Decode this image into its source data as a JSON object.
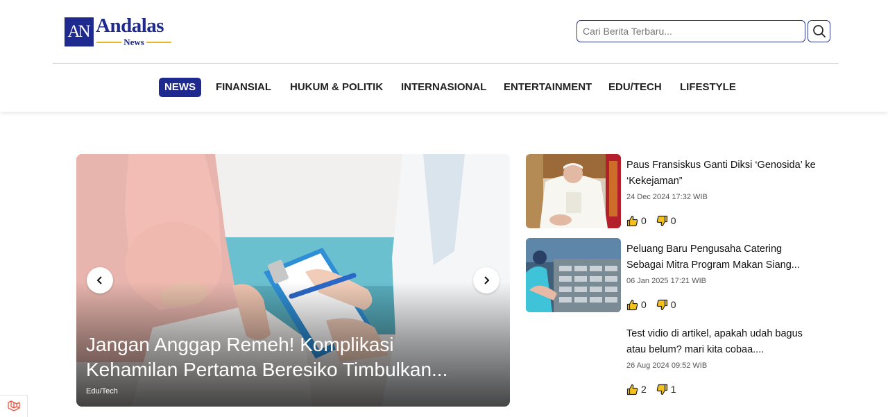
{
  "brand": {
    "mark": "AN",
    "name": "Andalas",
    "sub": "News"
  },
  "search": {
    "placeholder": "Cari Berita Terbaru..."
  },
  "nav": [
    {
      "label": "NEWS",
      "active": true
    },
    {
      "label": "FINANSIAL"
    },
    {
      "label": "HUKUM & POLITIK"
    },
    {
      "label": "INTERNASIONAL"
    },
    {
      "label": "ENTERTAINMENT"
    },
    {
      "label": "EDU/TECH"
    },
    {
      "label": "LIFESTYLE"
    }
  ],
  "hero": {
    "title": "Jangan Anggap Remeh! Komplikasi Kehamilan Pertama Beresiko Timbulkan...",
    "category": "Edu/Tech"
  },
  "articles": [
    {
      "title": "Paus Fransiskus Ganti Diksi ‘Genosida’ ke ‘Kekejaman”",
      "date": "24 Dec 2024 17:32 WIB",
      "likes": "0",
      "dislikes": "0"
    },
    {
      "title": "Peluang Baru Pengusaha Catering Sebagai Mitra Program Makan Siang...",
      "date": "06 Jan 2025 17:21 WIB",
      "likes": "0",
      "dislikes": "0"
    },
    {
      "title": "Test vidio di artikel, apakah udah bagus atau belum? mari kita cobaa....",
      "date": "26 Aug 2024 09:52 WIB",
      "likes": "2",
      "dislikes": "1"
    }
  ],
  "colors": {
    "brand": "#1f2a8f",
    "accent": "#e8b730",
    "like": "#f4c21b"
  }
}
